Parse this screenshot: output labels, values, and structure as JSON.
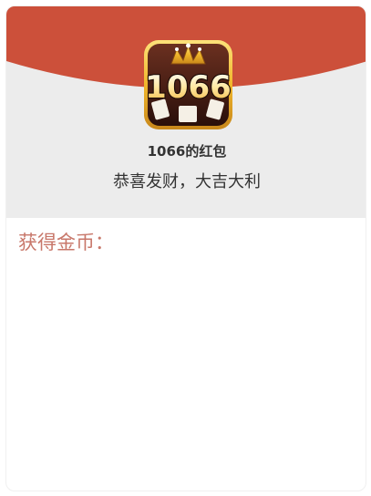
{
  "envelope": {
    "sender_title": "1066的红包",
    "greeting": "恭喜发财，大吉大利",
    "coins_label": "获得金币：",
    "logo_text": "1066",
    "logo_icon": "1066-game-logo-icon"
  },
  "colors": {
    "cap_red": "#cc503a",
    "header_bg": "#ececec",
    "coins_label": "#c8776a",
    "logo_gold": "#f3c234",
    "logo_dark": "#3a1a12"
  }
}
